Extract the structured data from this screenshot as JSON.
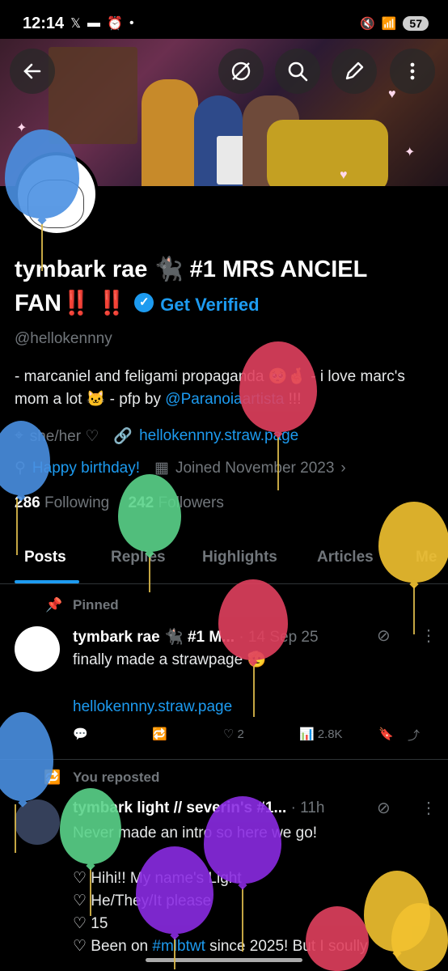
{
  "status": {
    "time": "12:14",
    "battery": "57",
    "signal": "6"
  },
  "banner": {
    "description_icon": "banner-image"
  },
  "header_buttons": [
    "back-arrow-icon",
    "grok-icon",
    "search-icon",
    "edit-icon",
    "more-icon"
  ],
  "profile": {
    "name_main": "tymbark rae 🐈‍⬛ #1 MRS ANCIEL FAN",
    "name_bangs": "‼️ ‼️",
    "get_verified": "Get Verified",
    "handle": "@hellokennny",
    "bio_text": "- marcaniel and feligami propaganda 🥺🤞 - i love marc's mom a lot 🐱 - pfp by ",
    "bio_mention": "@Paranoiaartista",
    "bio_end": " !!!",
    "pronouns": "she/her ♡",
    "website": "hellokennny.straw.page",
    "birthday": "Happy birthday!",
    "joined": "Joined November 2023",
    "following_count": "286",
    "following_label": "Following",
    "followers_count": "242",
    "followers_label": "Followers"
  },
  "tabs": [
    "Posts",
    "Replies",
    "Highlights",
    "Articles",
    "Me"
  ],
  "pinned": {
    "label": "Pinned",
    "author": "tymbark rae 🐈‍⬛ #1 M...",
    "date": "· 14 Sep 25",
    "text": "finally made a strawpage 🫡",
    "link": "hellokennny.straw.page",
    "replies": "",
    "retweets": "",
    "likes": "2",
    "views": "2.8K"
  },
  "repost": {
    "label": "You reposted",
    "author": "tymbark light // severin's #1...",
    "date": "· 11h",
    "line1": "Never made an intro so here we go!",
    "line2": "♡ Hihi!! My name's Light",
    "line3": "♡ He/They/It please",
    "line4": "♡ 15",
    "line5_pre": "♡ Been on ",
    "line5_tag": "#mlbtwt",
    "line5_post": " since 2025! But I soully"
  },
  "colors": {
    "accent": "#1d9bf0",
    "balloon_blue": "#4a90e2",
    "balloon_red": "#e0405e",
    "balloon_green": "#5ad38a",
    "balloon_yellow": "#f2c230",
    "balloon_purple": "#8a2be2"
  }
}
